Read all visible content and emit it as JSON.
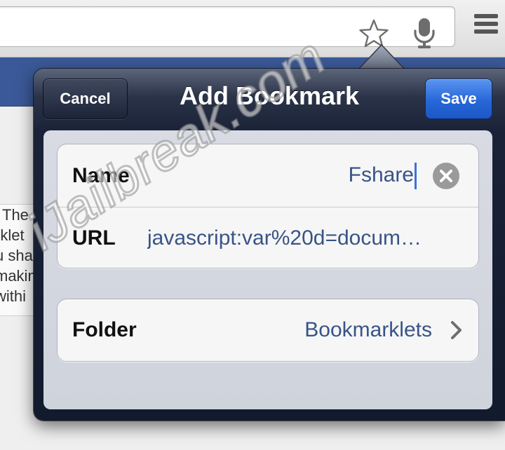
{
  "browser": {
    "icons": [
      "star-icon",
      "microphone-icon",
      "menu-icon"
    ]
  },
  "popover": {
    "title": "Add Bookmark",
    "cancel_label": "Cancel",
    "save_label": "Save",
    "fields": {
      "name_label": "Name",
      "name_value": "Fshare",
      "url_label": "URL",
      "url_value": "javascript:var%20d=docum…",
      "folder_label": "Folder",
      "folder_value": "Bookmarklets"
    },
    "colors": {
      "save_button": "#2767d8",
      "value_text": "#385487",
      "caret": "#3b6fe0"
    }
  },
  "background_page": {
    "snippet_lines": [
      " The",
      "rklet",
      "u sha",
      "makin",
      "withi"
    ]
  },
  "watermark": "iJailbreak.com"
}
